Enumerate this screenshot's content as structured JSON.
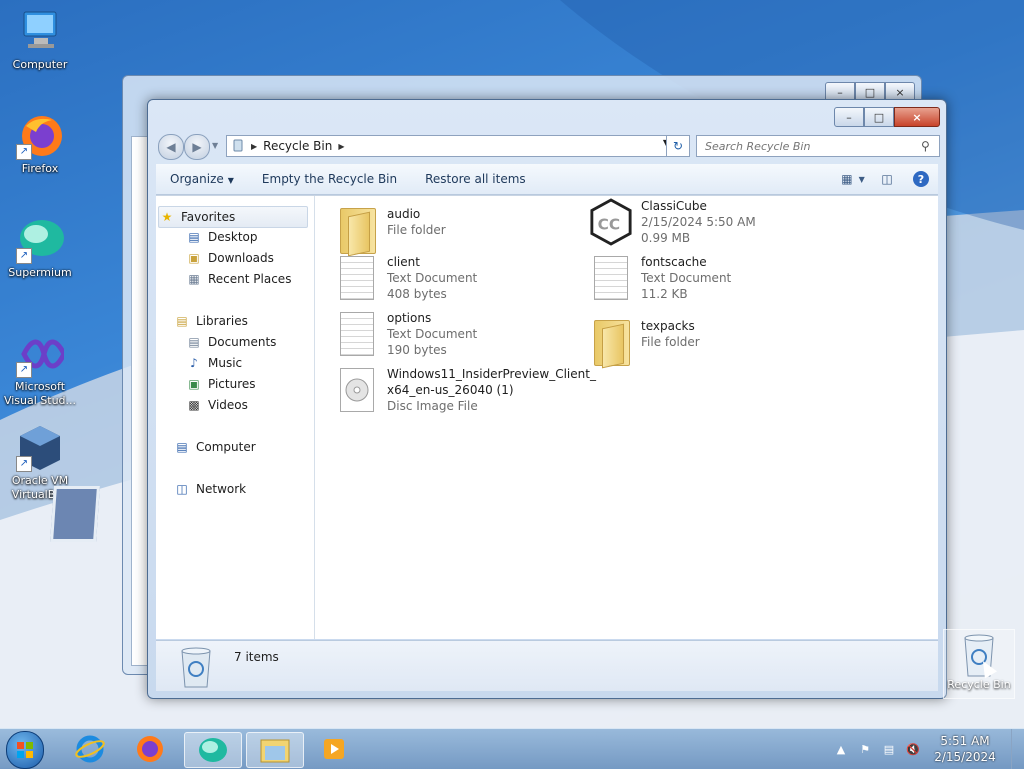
{
  "desktop": {
    "icons": [
      {
        "label": "Computer"
      },
      {
        "label": "Firefox"
      },
      {
        "label": "Supermium"
      },
      {
        "label": "Microsoft Visual Stud..."
      },
      {
        "label": "Oracle VM VirtualBox"
      }
    ],
    "recycle_bin_label": "Recycle Bin"
  },
  "window": {
    "address": {
      "location": "Recycle Bin"
    },
    "search": {
      "placeholder": "Search Recycle Bin"
    },
    "toolbar": {
      "organize": "Organize",
      "empty": "Empty the Recycle Bin",
      "restore": "Restore all items"
    },
    "nav": {
      "favorites": "Favorites",
      "desktop": "Desktop",
      "downloads": "Downloads",
      "recent": "Recent Places",
      "libraries": "Libraries",
      "documents": "Documents",
      "music": "Music",
      "pictures": "Pictures",
      "videos": "Videos",
      "computer": "Computer",
      "network": "Network"
    },
    "files": [
      {
        "name": "audio",
        "line2": "File folder",
        "line3": "",
        "icon": "folder-icon"
      },
      {
        "name": "ClassiCube",
        "line2": "2/15/2024 5:50 AM",
        "line3": "0.99 MB",
        "icon": "classicube-icon"
      },
      {
        "name": "client",
        "line2": "Text Document",
        "line3": "408 bytes",
        "icon": "text-document-icon"
      },
      {
        "name": "fontscache",
        "line2": "Text Document",
        "line3": "11.2 KB",
        "icon": "text-document-icon"
      },
      {
        "name": "options",
        "line2": "Text Document",
        "line3": "190 bytes",
        "icon": "text-document-icon"
      },
      {
        "name": "texpacks",
        "line2": "File folder",
        "line3": "",
        "icon": "folder-icon"
      },
      {
        "name": "Windows11_InsiderPreview_Client_",
        "name2": "x64_en-us_26040 (1)",
        "line2": "Disc Image File",
        "icon": "disc-image-icon"
      }
    ],
    "status": {
      "count": "7 items"
    }
  },
  "taskbar": {
    "clock_time": "5:51 AM",
    "clock_date": "2/15/2024"
  }
}
